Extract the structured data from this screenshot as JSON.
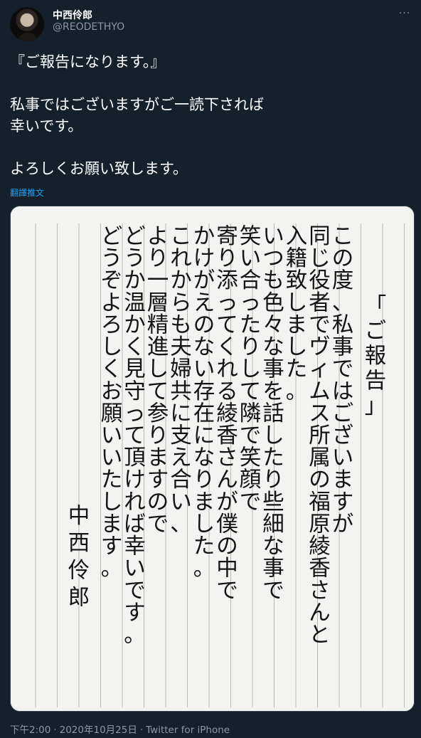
{
  "user": {
    "display_name": "中西伶郎",
    "handle": "@REODETHYO"
  },
  "more_label": "···",
  "tweet": {
    "text": "『ご報告になります。』\n\n私事ではございますがご一読下されば\n幸いです。\n\nよろしくお願い致します。"
  },
  "translate_label": "翻譯推文",
  "letter": {
    "title": "「ご報告」",
    "lines": [
      "この度、私事ではございますが",
      "同じ役者でヴィムス所属の福原綾香さんと",
      "入籍致しました。",
      "いつも色々な事を話したり些細な事で",
      "笑い合ったりして隣で笑顔で",
      "寄り添ってくれる綾香さんが僕の中で",
      "かけがえのない存在になりました。",
      "これからも夫婦共に支え合い、",
      "より一層精進して参りますので",
      "どうか温かく見守って頂ければ幸いです。",
      "どうぞよろしくお願いいたします。"
    ],
    "signature": "中西伶郎"
  },
  "footer": {
    "time": "下午2:00",
    "date": "2020年10月25日",
    "separator": "·",
    "source": "Twitter for iPhone"
  },
  "colors": {
    "background": "#15202b",
    "secondary_text": "#8899a6",
    "link": "#1da1f2",
    "paper": "#f3f3f1",
    "paper_lines": "#b9b9b6",
    "ink": "#141414"
  }
}
